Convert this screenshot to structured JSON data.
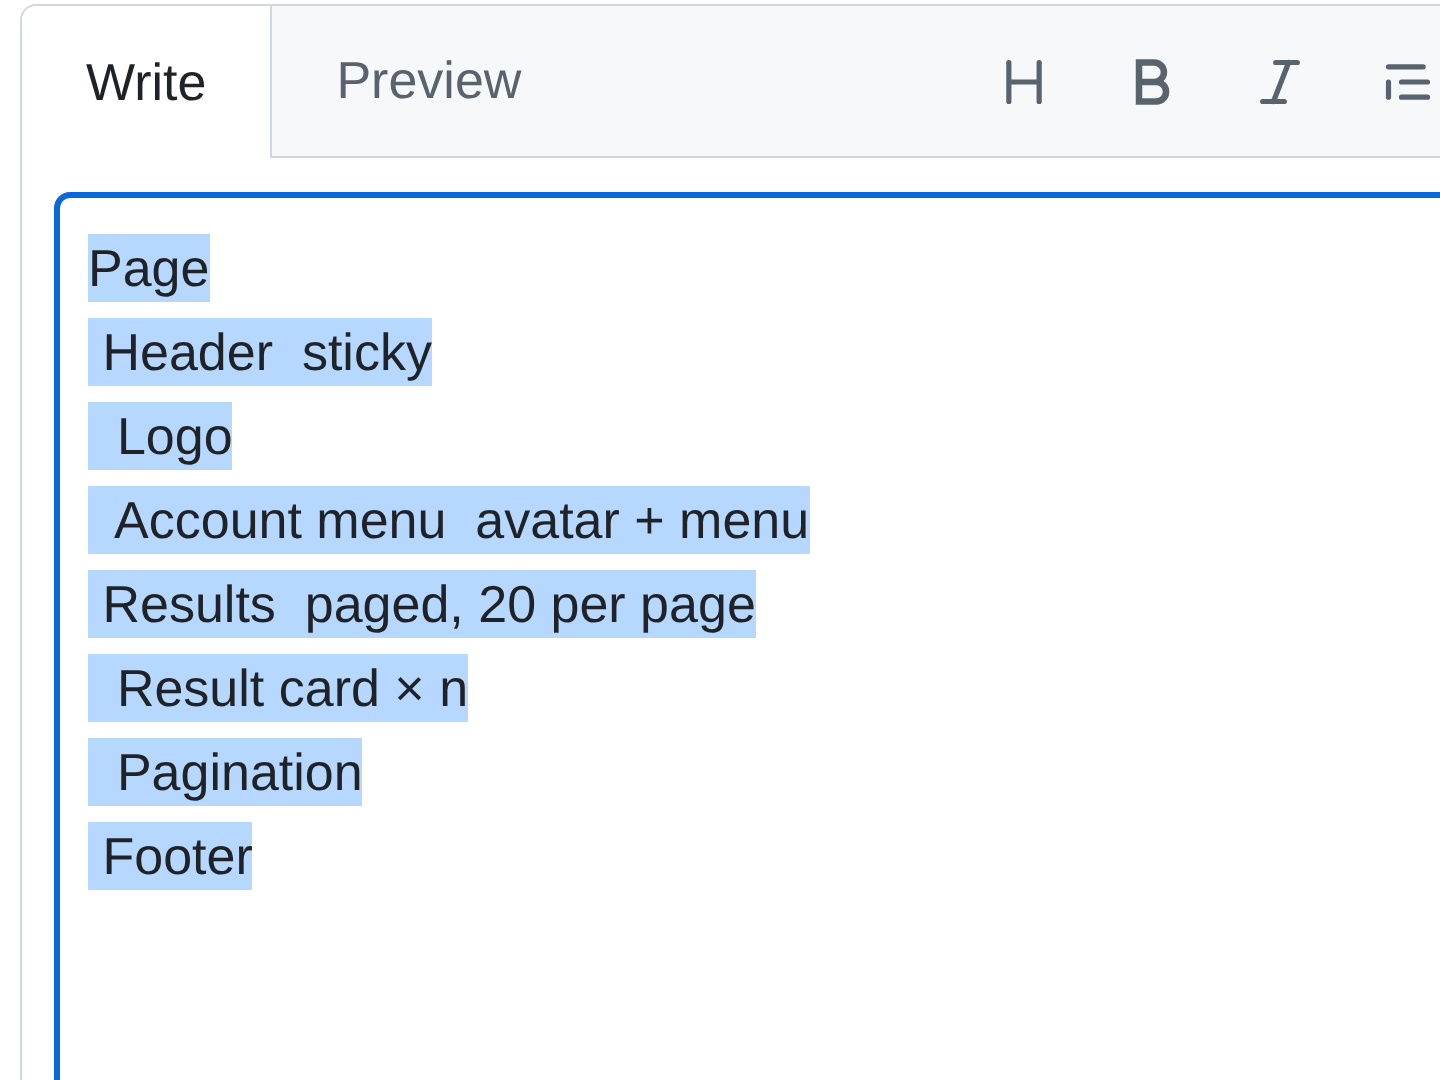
{
  "tabs": [
    {
      "label": "Write",
      "selected": true
    },
    {
      "label": "Preview",
      "selected": false
    }
  ],
  "editor": {
    "selected": true,
    "lines": [
      "Page",
      " Header  sticky",
      "  Logo",
      "  Account menu  avatar + menu",
      " Results  paged, 20 per page",
      "  Result card × n",
      "  Pagination",
      " Footer"
    ]
  }
}
